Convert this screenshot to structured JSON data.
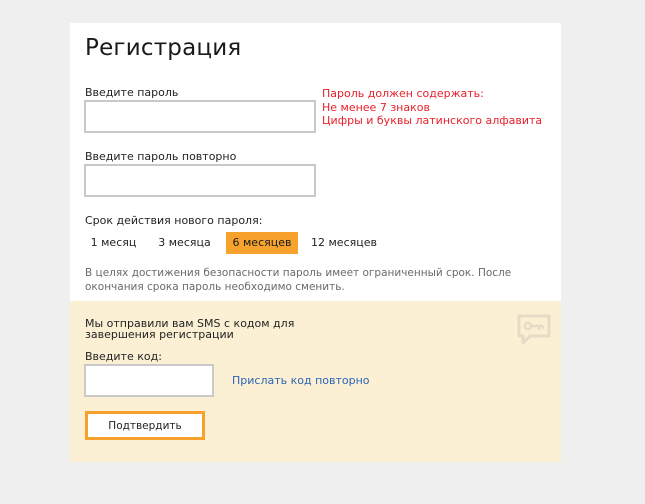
{
  "page": {
    "title": "Регистрация"
  },
  "password": {
    "label": "Введите пароль",
    "value": "",
    "placeholder": ""
  },
  "password_repeat": {
    "label": "Введите пароль повторно",
    "value": "",
    "placeholder": ""
  },
  "requirements": {
    "heading": "Пароль должен содержать:",
    "items": [
      "Не менее 7 знаков",
      "Цифры и буквы латинского алфавита"
    ]
  },
  "validity": {
    "label": "Срок действия нового пароля:",
    "options": [
      "1 месяц",
      "3 месяца",
      "6 месяцев",
      "12 месяцев"
    ],
    "selected": "6 месяцев"
  },
  "note": "В целях достижения безопасности пароль имеет ограниченный срок. После окончания срока пароль необходимо сменить.",
  "sms": {
    "message": "Мы отправили вам SMS с кодом для завершения регистрации",
    "code_label": "Введите код:",
    "code_value": "",
    "resend_label": "Прислать код повторно",
    "confirm_label": "Подтвердить",
    "icon": "sms-key-icon"
  },
  "colors": {
    "accent": "#f6a22d",
    "panel": "#fcf0d4",
    "error": "#e8202a",
    "link": "#2a64b5"
  }
}
